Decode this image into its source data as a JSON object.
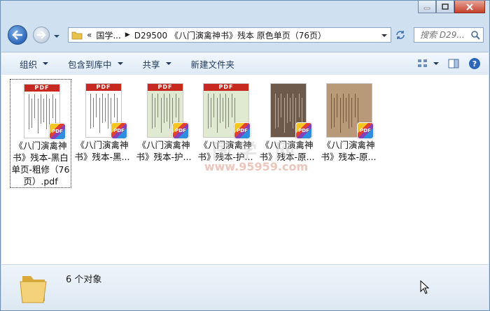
{
  "window": {
    "controls": [
      "minimize",
      "maximize",
      "close"
    ]
  },
  "nav": {
    "breadcrumb_prefix": "«",
    "breadcrumb": [
      "国学...",
      "D29500 《八门演禽神书》残本 原色单页（76页）"
    ],
    "search_placeholder": "搜索 D29..."
  },
  "toolbar": {
    "organize": "组织",
    "include_in_library": "包含到库中",
    "share": "共享",
    "new_folder": "新建文件夹"
  },
  "files": [
    {
      "name": "《八门演禽神书》残本-黑白单页-粗修（76页）.pdf",
      "style": "white",
      "selected": true
    },
    {
      "name": "《八门演禽神书》残本-黑...",
      "style": "white",
      "selected": false
    },
    {
      "name": "《八门演禽神书》残本-护...",
      "style": "green",
      "selected": false
    },
    {
      "name": "《八门演禽神书》残本-护...",
      "style": "green",
      "selected": false
    },
    {
      "name": "《八门演禽神书》残本-原...",
      "style": "dark",
      "selected": false
    },
    {
      "name": "《八门演禽神书》残本-原...",
      "style": "brown",
      "selected": false
    }
  ],
  "pdf_label": "PDF",
  "watermark": {
    "text": "国学 网",
    "url": "www.95959.com"
  },
  "status": {
    "count_text": "6 个对象"
  },
  "colors": {
    "pdf_red": "#c7281f",
    "toolbar_text": "#1e395b",
    "frame": "#cfe0f1"
  }
}
